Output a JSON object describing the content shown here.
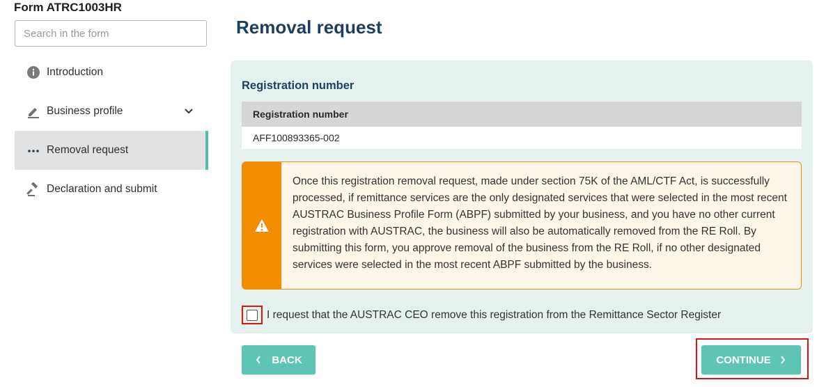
{
  "form": {
    "title": "Form ATRC1003HR"
  },
  "search": {
    "placeholder": "Search in the form",
    "value": ""
  },
  "sidebar": {
    "items": [
      {
        "label": "Introduction",
        "icon": "info-icon",
        "active": false
      },
      {
        "label": "Business profile",
        "icon": "pencil-icon",
        "active": false,
        "expandable": true
      },
      {
        "label": "Removal request",
        "icon": "ellipsis-icon",
        "active": true
      },
      {
        "label": "Declaration and submit",
        "icon": "gavel-icon",
        "active": false
      }
    ]
  },
  "main": {
    "title": "Removal request",
    "section_title": "Registration number",
    "table": {
      "header": "Registration number",
      "value": "AFF100893365-002"
    },
    "warning": {
      "icon": "warning-icon",
      "text": "Once this registration removal request, made under section 75K of the AML/CTF Act, is successfully processed, if remittance services are the only designated services that were selected in the most recent AUSTRAC Business Profile Form (ABPF) submitted by your business, and you have no other current registration with AUSTRAC, the business will also be automatically removed from the RE Roll. By submitting this form, you approve removal of the business from the RE Roll, if no other designated services were selected in the most recent ABPF submitted by the business."
    },
    "checkbox": {
      "label": "I request that the AUSTRAC CEO remove this registration from the Remittance Sector Register",
      "checked": false
    }
  },
  "buttons": {
    "back": "BACK",
    "continue": "CONTINUE"
  },
  "colors": {
    "accent": "#5ec4b4",
    "title": "#1d3f5e",
    "warning": "#f28c00",
    "panel_bg": "#e5f1ef",
    "highlight": "#e11414"
  }
}
